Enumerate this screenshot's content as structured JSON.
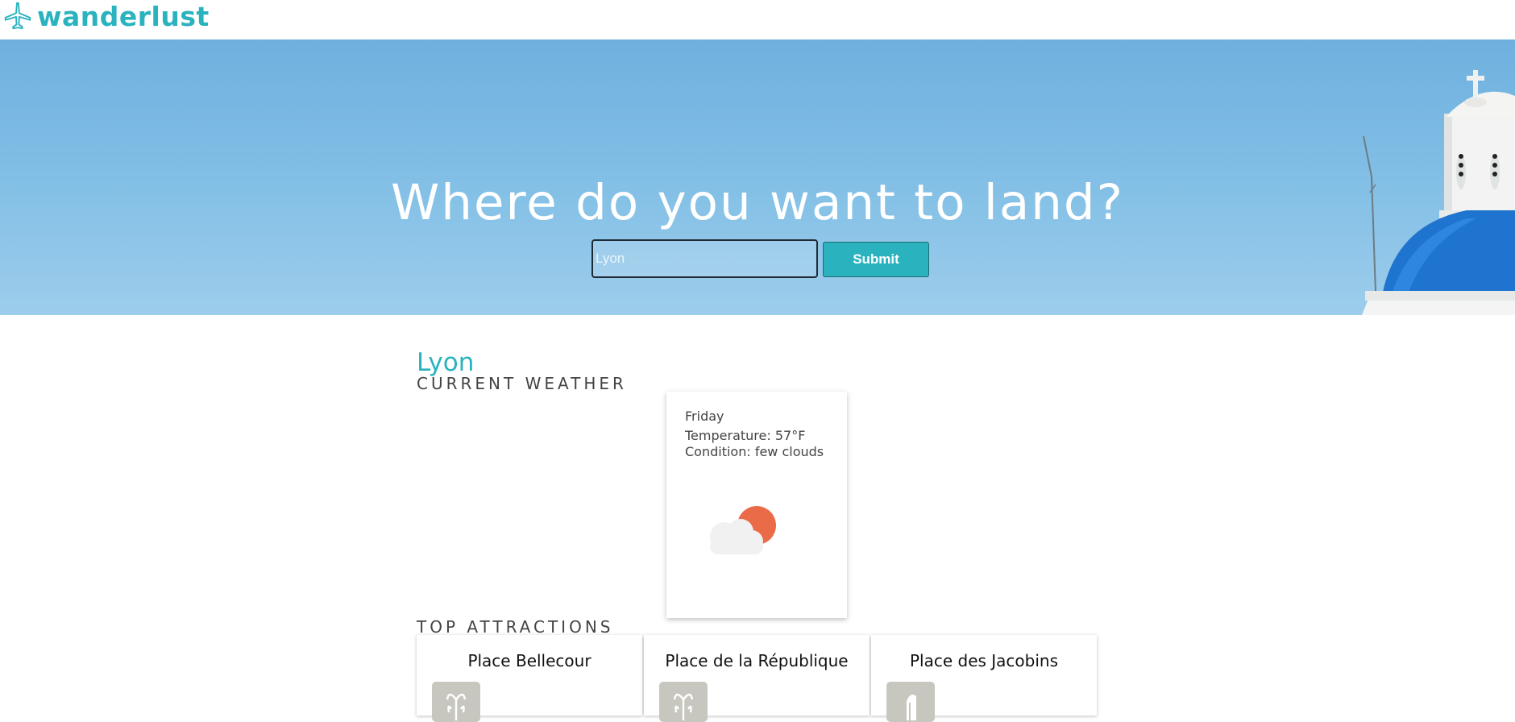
{
  "header": {
    "brand": "wanderlust",
    "logo_icon": "airplane-icon"
  },
  "hero": {
    "title": "Where do you want to land?",
    "search": {
      "value": "",
      "placeholder": "Lyon"
    },
    "submit_label": "Submit"
  },
  "city": {
    "name": "Lyon"
  },
  "weather": {
    "section_label": "CURRENT WEATHER",
    "day": "Friday",
    "temperature": "Temperature: 57°F",
    "condition": "Condition: few clouds",
    "icon": "partly-cloudy-icon"
  },
  "attractions": {
    "section_label": "TOP ATTRACTIONS",
    "items": [
      {
        "name": "Place Bellecour",
        "icon": "fountain-icon"
      },
      {
        "name": "Place de la République",
        "icon": "fountain-icon"
      },
      {
        "name": "Place des Jacobins",
        "icon": "monument-icon"
      }
    ]
  },
  "colors": {
    "accent": "#2ab3bf",
    "sun": "#ea6b47",
    "icon_bg": "#c7c7c0"
  }
}
